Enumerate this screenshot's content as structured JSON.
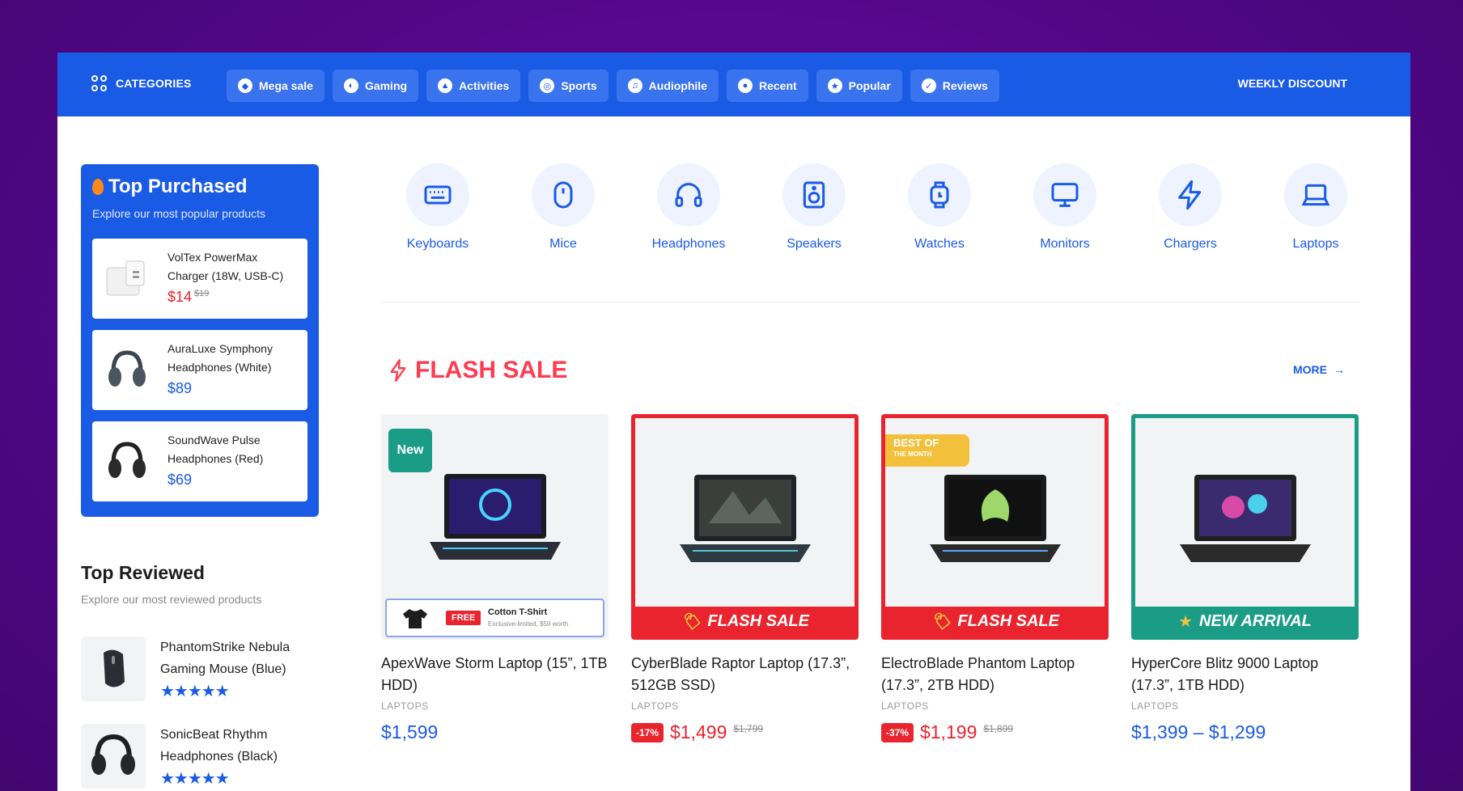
{
  "nav": {
    "categories_label": "CATEGORIES",
    "pills": [
      {
        "label": "Mega sale",
        "icon": "mega-sale-icon"
      },
      {
        "label": "Gaming",
        "icon": "gaming-icon"
      },
      {
        "label": "Activities",
        "icon": "activities-icon"
      },
      {
        "label": "Sports",
        "icon": "sports-icon"
      },
      {
        "label": "Audiophile",
        "icon": "audiophile-icon"
      },
      {
        "label": "Recent",
        "icon": "recent-icon"
      },
      {
        "label": "Popular",
        "icon": "popular-icon"
      },
      {
        "label": "Reviews",
        "icon": "reviews-icon"
      }
    ],
    "weekly_discount": "WEEKLY DISCOUNT"
  },
  "top_purchased": {
    "title": "Top Purchased",
    "subtitle": "Explore our most popular products",
    "items": [
      {
        "name": "VolTex PowerMax Charger (18W, USB-C)",
        "price": "$14",
        "old_price": "$19"
      },
      {
        "name": "AuraLuxe Symphony Headphones (White)",
        "price": "$89"
      },
      {
        "name": "SoundWave Pulse Headphones (Red)",
        "price": "$69"
      }
    ]
  },
  "top_reviewed": {
    "title": "Top Reviewed",
    "subtitle": "Explore our most reviewed products",
    "items": [
      {
        "name": "PhantomStrike Nebula Gaming Mouse (Blue)",
        "stars": "★★★★★"
      },
      {
        "name": "SonicBeat Rhythm Headphones (Black)",
        "stars": "★★★★★"
      }
    ]
  },
  "categories": [
    {
      "label": "Keyboards",
      "icon": "keyboard-icon"
    },
    {
      "label": "Mice",
      "icon": "mouse-icon"
    },
    {
      "label": "Headphones",
      "icon": "headphones-icon"
    },
    {
      "label": "Speakers",
      "icon": "speaker-icon"
    },
    {
      "label": "Watches",
      "icon": "watch-icon"
    },
    {
      "label": "Monitors",
      "icon": "monitor-icon"
    },
    {
      "label": "Chargers",
      "icon": "charger-icon"
    },
    {
      "label": "Laptops",
      "icon": "laptop-icon"
    }
  ],
  "flash_sale": {
    "title": "FLASH SALE",
    "more": "MORE",
    "products": [
      {
        "name": "ApexWave Storm Laptop (15”, 1TB HDD)",
        "category": "LAPTOPS",
        "price": "$1,599",
        "badge": "New",
        "promo": {
          "free": "FREE",
          "title": "Cotton T-Shirt",
          "sub": "Exclusive-limited, $59 worth"
        }
      },
      {
        "name": "CyberBlade Raptor Laptop (17.3”, 512GB SSD)",
        "category": "LAPTOPS",
        "price": "$1,499",
        "old_price": "$1,799",
        "discount": "-17%",
        "banner": "FLASH SALE"
      },
      {
        "name": "ElectroBlade Phantom Laptop (17.3”, 2TB HDD)",
        "category": "LAPTOPS",
        "price": "$1,199",
        "old_price": "$1,899",
        "discount": "-37%",
        "banner": "FLASH SALE",
        "best": {
          "line1": "BEST OF",
          "line2": "THE MONTH"
        }
      },
      {
        "name": "HyperCore Blitz 9000 Laptop (17.3”, 1TB HDD)",
        "category": "LAPTOPS",
        "price": "$1,399 – $1,299",
        "banner": "NEW ARRIVAL"
      }
    ]
  },
  "colors": {
    "primary": "#1a5be6",
    "sale_red": "#e9242e",
    "teal": "#1b9c87",
    "flash_title": "#ff3b52"
  }
}
